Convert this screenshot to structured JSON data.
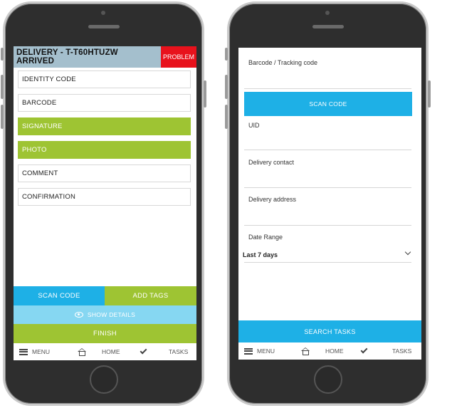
{
  "left_phone": {
    "header": {
      "title_line1": "DELIVERY - T-T60HTUZW",
      "title_line2": "ARRIVED",
      "problem_label": "PROBLEM"
    },
    "rows": [
      {
        "label": "IDENTITY CODE",
        "style": "white"
      },
      {
        "label": "BARCODE",
        "style": "white"
      },
      {
        "label": "SIGNATURE",
        "style": "green"
      },
      {
        "label": "PHOTO",
        "style": "green"
      },
      {
        "label": "COMMENT",
        "style": "white"
      },
      {
        "label": "CONFIRMATION",
        "style": "white"
      }
    ],
    "actions": {
      "scan_code": "SCAN CODE",
      "add_tags": "ADD TAGS",
      "show_details": "SHOW DETAILS",
      "finish": "FINISH"
    },
    "navbar": {
      "menu": "MENU",
      "home": "HOME",
      "tasks": "TASKS"
    }
  },
  "right_phone": {
    "fields": {
      "barcode_label": "Barcode / Tracking code",
      "uid_label": "UID",
      "contact_label": "Delivery contact",
      "address_label": "Delivery address",
      "date_range_label": "Date Range",
      "date_range_value": "Last 7 days"
    },
    "scan_code": "SCAN CODE",
    "search_tasks": "SEARCH TASKS",
    "navbar": {
      "menu": "MENU",
      "home": "HOME",
      "tasks": "TASKS"
    }
  },
  "colors": {
    "header_bg": "#a4bfcd",
    "problem_red": "#e8121c",
    "green": "#9ec433",
    "blue": "#1eb0e6",
    "light_blue": "#86d7f2"
  },
  "icons": [
    "menu-icon",
    "home-icon",
    "check-icon",
    "eye-icon",
    "chevron-down-icon"
  ]
}
